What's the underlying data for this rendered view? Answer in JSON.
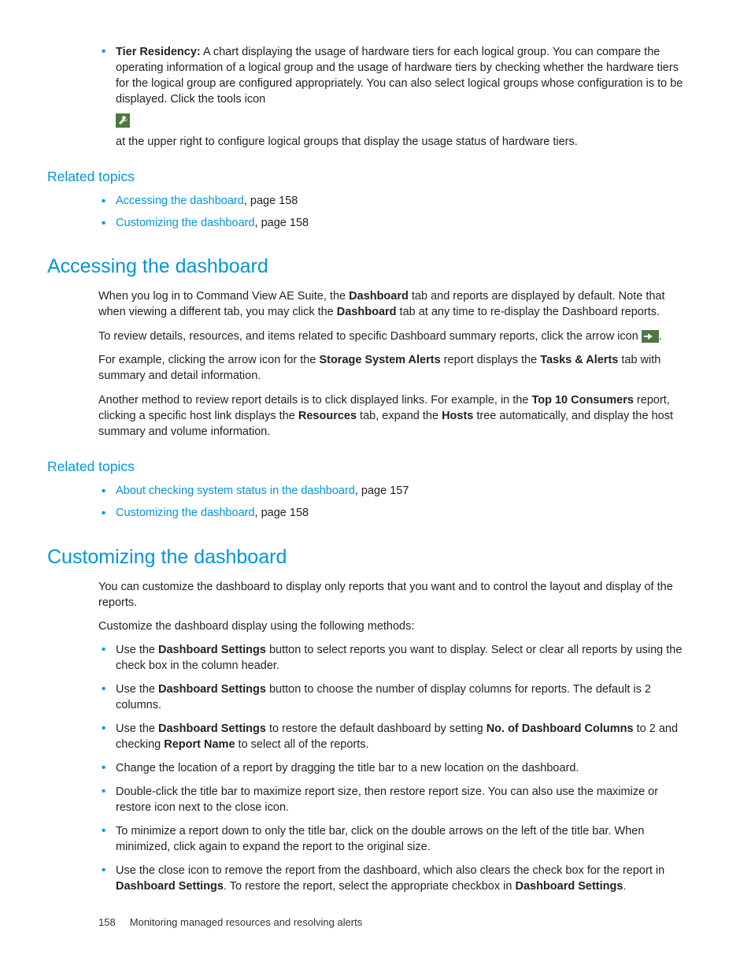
{
  "tierResidency": {
    "label": "Tier Residency:",
    "text1": " A chart displaying the usage of hardware tiers for each logical group. You can compare the operating information of a logical group and the usage of hardware tiers by checking whether the hardware tiers for the logical group are configured appropriately. You can also select logical groups whose configuration is to be displayed. Click the tools icon",
    "text2": "at the upper right to configure logical groups that display the usage status of hardware tiers."
  },
  "related1": {
    "heading": "Related topics",
    "items": [
      {
        "link": "Accessing the dashboard",
        "suffix": ", page 158"
      },
      {
        "link": "Customizing the dashboard",
        "suffix": ", page 158"
      }
    ]
  },
  "accessing": {
    "heading": "Accessing the dashboard",
    "p1a": "When you log in to Command View AE Suite, the ",
    "p1b": "Dashboard",
    "p1c": " tab and reports are displayed by default. Note that when viewing a different tab, you may click the ",
    "p1d": "Dashboard",
    "p1e": " tab at any time to re-display the Dashboard reports.",
    "p2a": "To review details, resources, and items related to specific Dashboard summary reports, click the arrow icon ",
    "p2b": ".",
    "p3a": "For example, clicking the arrow icon for the ",
    "p3b": "Storage System Alerts",
    "p3c": " report displays the ",
    "p3d": "Tasks & Alerts",
    "p3e": " tab with summary and detail information.",
    "p4a": "Another method to review report details is to click displayed links. For example, in the ",
    "p4b": "Top 10 Consumers",
    "p4c": " report, clicking a specific host link displays the ",
    "p4d": "Resources",
    "p4e": " tab, expand the ",
    "p4f": "Hosts",
    "p4g": " tree automatically, and display the host summary and volume information."
  },
  "related2": {
    "heading": "Related topics",
    "items": [
      {
        "link": "About checking system status in the dashboard",
        "suffix": ", page 157"
      },
      {
        "link": "Customizing the dashboard",
        "suffix": ", page 158"
      }
    ]
  },
  "customizing": {
    "heading": "Customizing the dashboard",
    "p1": "You can customize the dashboard to display only reports that you want and to control the layout and display of the reports.",
    "p2": "Customize the dashboard display using the following methods:",
    "items": {
      "b1a": "Use the ",
      "b1b": "Dashboard Settings",
      "b1c": " button to select reports you want to display. Select or clear all reports by using the check box in the column header.",
      "b2a": "Use the ",
      "b2b": "Dashboard Settings",
      "b2c": " button to choose the number of display columns for reports. The default is 2 columns.",
      "b3a": "Use the ",
      "b3b": "Dashboard Settings",
      "b3c": " to restore the default dashboard by setting ",
      "b3d": "No. of Dashboard Columns",
      "b3e": " to 2 and checking ",
      "b3f": "Report Name",
      "b3g": " to select all of the reports.",
      "b4": "Change the location of a report by dragging the title bar to a new location on the dashboard.",
      "b5": "Double-click the title bar to maximize report size, then restore report size. You can also use the maximize or restore icon next to the close icon.",
      "b6": "To minimize a report down to only the title bar, click on the double arrows on the left of the title bar. When minimized, click again to expand the report to the original size.",
      "b7a": "Use the close icon to remove the report from the dashboard, which also clears the check box for the report in ",
      "b7b": "Dashboard Settings",
      "b7c": ". To restore the report, select the appropriate checkbox in ",
      "b7d": "Dashboard Settings",
      "b7e": "."
    }
  },
  "footer": {
    "page": "158",
    "chapter": "Monitoring managed resources and resolving alerts"
  }
}
